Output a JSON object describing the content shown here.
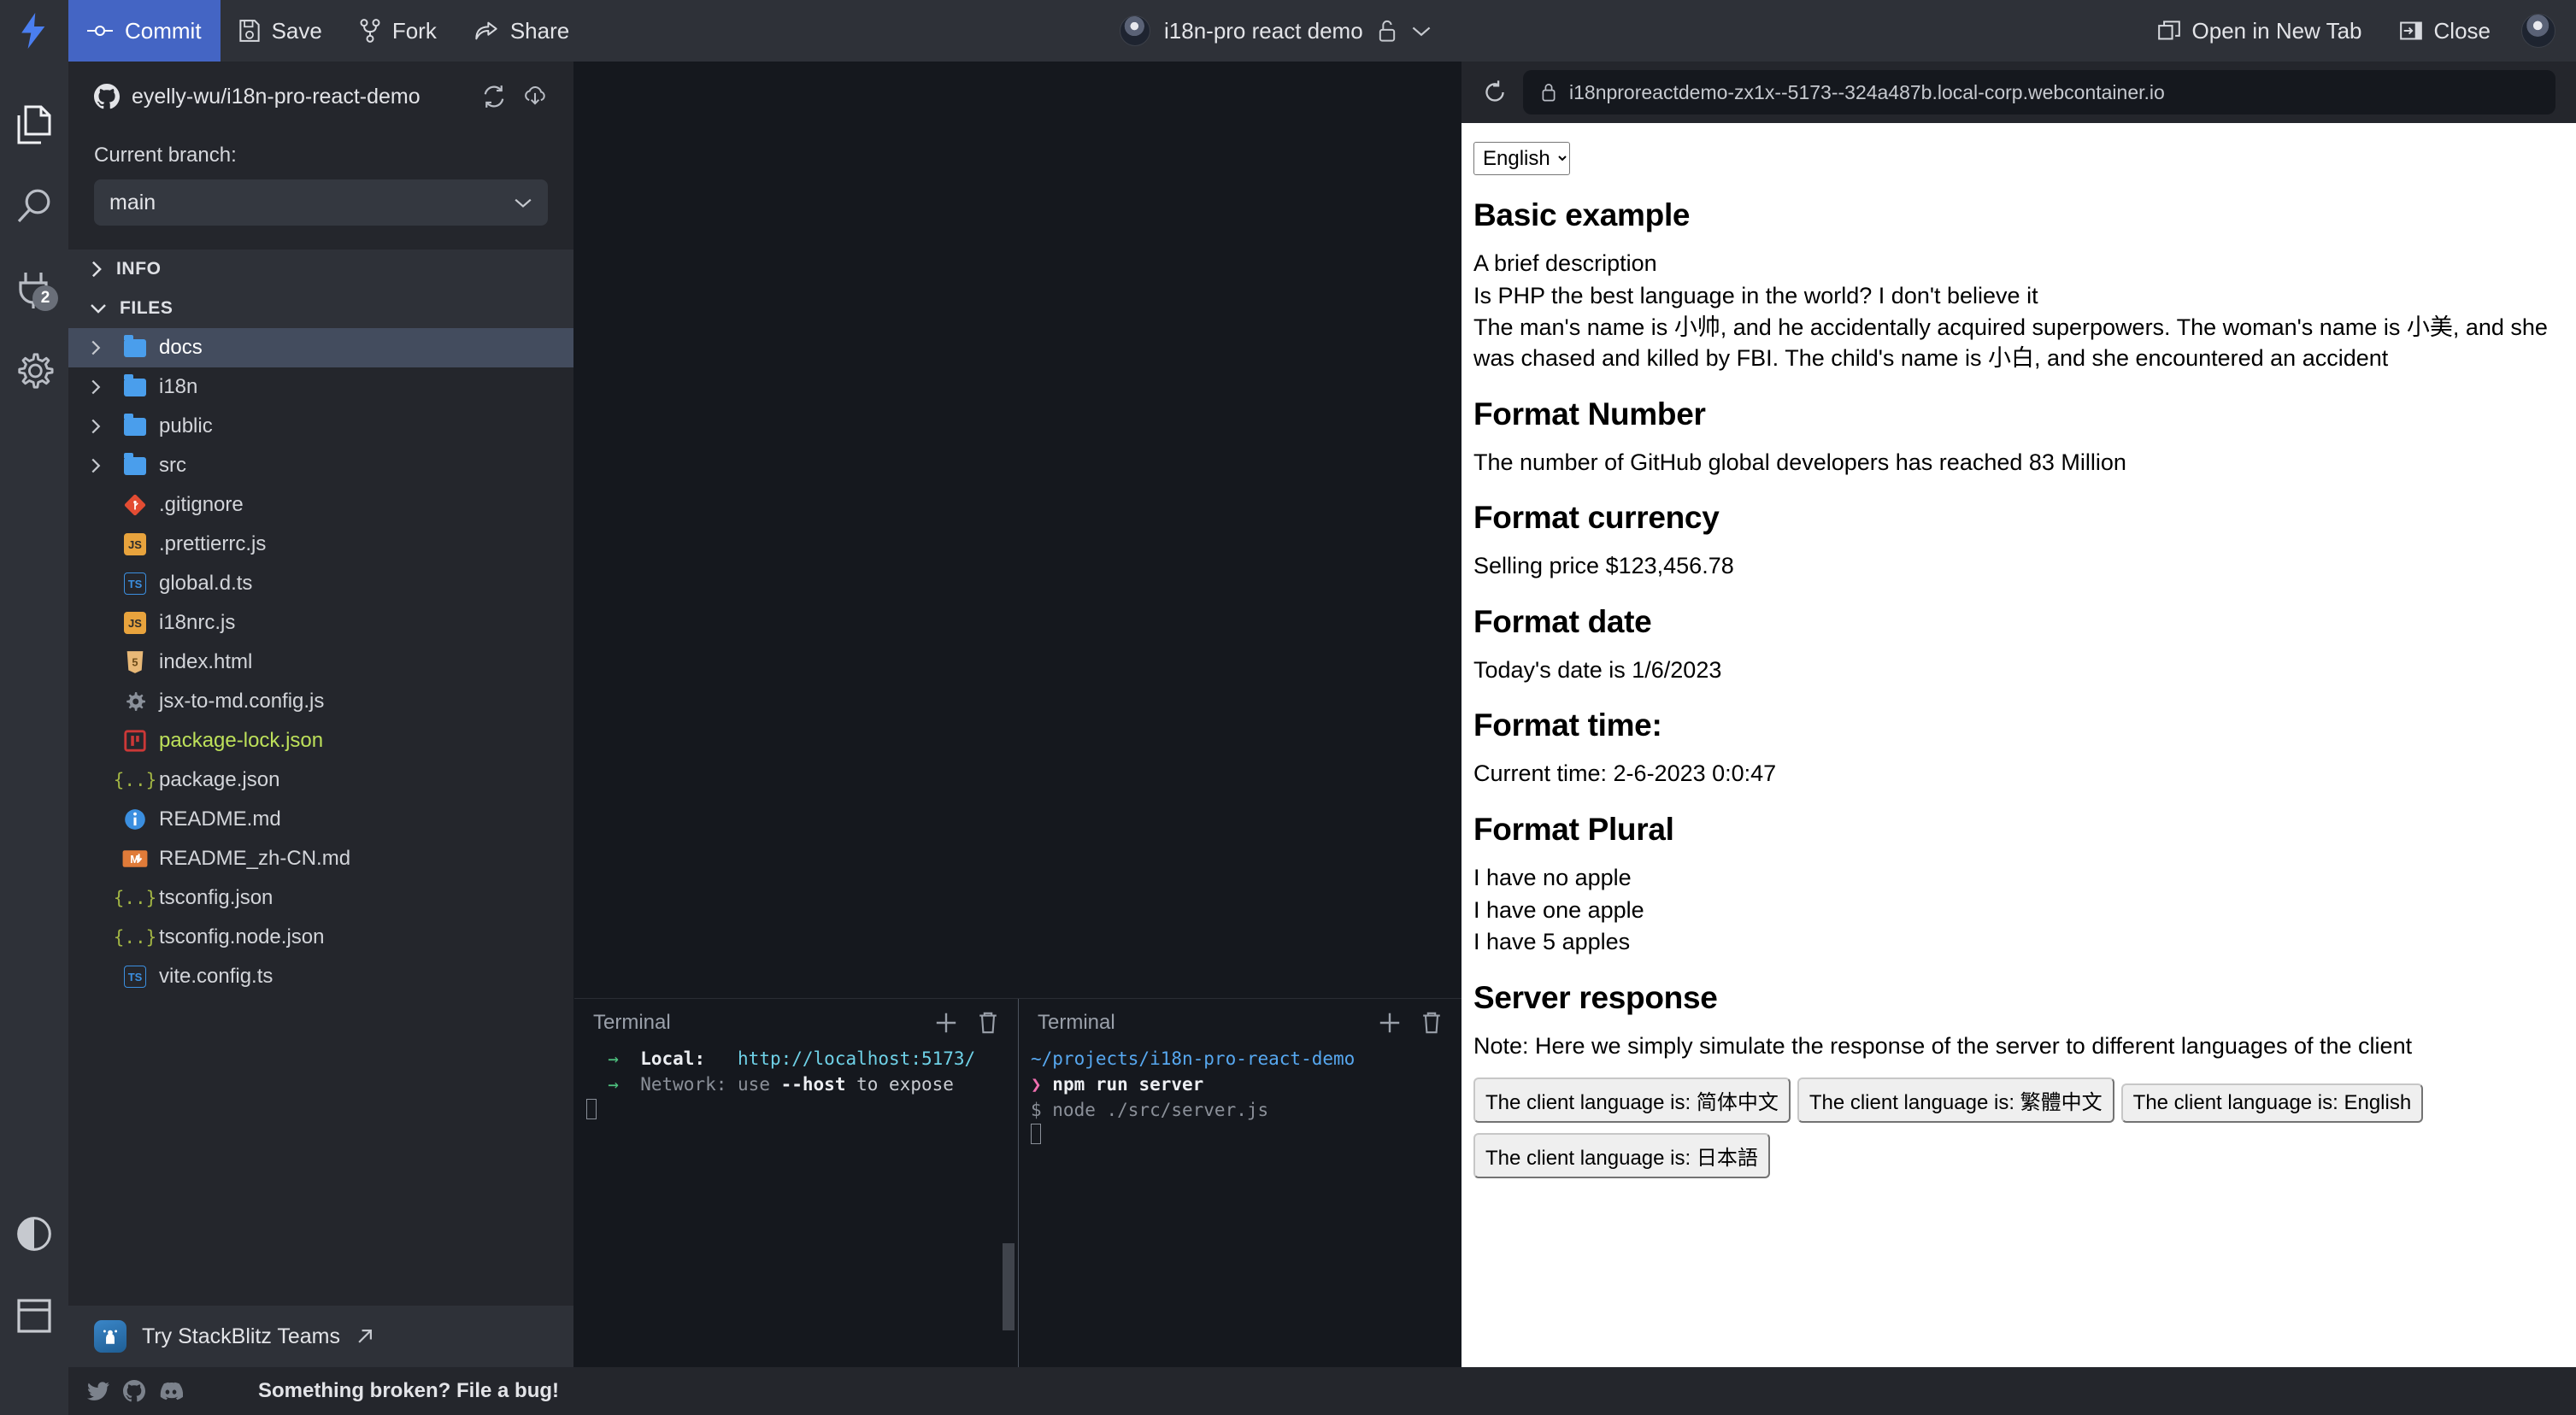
{
  "toolbar": {
    "logo_icon": "stackblitz-lightning-icon",
    "commit_label": "Commit",
    "save_label": "Save",
    "fork_label": "Fork",
    "share_label": "Share",
    "project_title": "i18n-pro react demo",
    "lock_icon": "unlock-icon",
    "chevron_icon": "chevron-down-icon",
    "open_new_tab_label": "Open in New Tab",
    "close_label": "Close",
    "commit_bg": "#4465c4"
  },
  "activity_bar": {
    "items": [
      {
        "icon": "files-icon",
        "name": "files"
      },
      {
        "icon": "search-icon",
        "name": "search"
      },
      {
        "icon": "plug-icon",
        "name": "plugins",
        "badge": "2"
      },
      {
        "icon": "gear-icon",
        "name": "settings"
      }
    ],
    "bottom": [
      {
        "icon": "theme-contrast-icon",
        "name": "theme"
      },
      {
        "icon": "layout-panel-icon",
        "name": "layout"
      }
    ]
  },
  "sidebar": {
    "repo_name": "eyelly-wu/i18n-pro-react-demo",
    "repo_icon": "github-icon",
    "sync_icon": "sync-icon",
    "pull_icon": "cloud-download-icon",
    "branch_label": "Current branch:",
    "branch_value": "main",
    "sections": [
      {
        "label": "INFO",
        "expanded": false
      },
      {
        "label": "FILES",
        "expanded": true
      }
    ],
    "files": [
      {
        "name": "docs",
        "type": "folder",
        "selected": true
      },
      {
        "name": "i18n",
        "type": "folder",
        "selected": false
      },
      {
        "name": "public",
        "type": "folder",
        "selected": false
      },
      {
        "name": "src",
        "type": "folder",
        "selected": false
      },
      {
        "name": ".gitignore",
        "type": "file",
        "icon": "git-icon",
        "color": "#e34c33"
      },
      {
        "name": ".prettierrc.js",
        "type": "file",
        "icon": "js-icon",
        "color": "#e8a33d",
        "label": "JS"
      },
      {
        "name": "global.d.ts",
        "type": "file",
        "icon": "ts-icon",
        "color": "#3b8fe0",
        "label": "TS"
      },
      {
        "name": "i18nrc.js",
        "type": "file",
        "icon": "js-icon",
        "color": "#e8a33d",
        "label": "JS"
      },
      {
        "name": "index.html",
        "type": "file",
        "icon": "html-icon",
        "color": "#e8b877"
      },
      {
        "name": "jsx-to-md.config.js",
        "type": "file",
        "icon": "gear-file-icon",
        "color": "#8b919b"
      },
      {
        "name": "package-lock.json",
        "type": "file",
        "icon": "npm-lock-icon",
        "color": "#cb3837",
        "modified": true
      },
      {
        "name": "package.json",
        "type": "file",
        "icon": "json-icon",
        "color": "#a3b644"
      },
      {
        "name": "README.md",
        "type": "file",
        "icon": "info-icon",
        "color": "#3b8fe0"
      },
      {
        "name": "README_zh-CN.md",
        "type": "file",
        "icon": "markdown-icon",
        "color": "#e07b39"
      },
      {
        "name": "tsconfig.json",
        "type": "file",
        "icon": "json-icon",
        "color": "#a3b644"
      },
      {
        "name": "tsconfig.node.json",
        "type": "file",
        "icon": "json-icon",
        "color": "#a3b644"
      },
      {
        "name": "vite.config.ts",
        "type": "file",
        "icon": "ts-icon",
        "color": "#3b8fe0",
        "label": "TS"
      }
    ],
    "teams_label": "Try StackBlitz Teams",
    "teams_icon": "teams-icon",
    "external_icon": "arrow-up-right-icon"
  },
  "terminals": [
    {
      "title": "Terminal",
      "add_icon": "plus-icon",
      "delete_icon": "trash-icon",
      "lines": [
        {
          "segments": [
            {
              "text": "  →  ",
              "style": "green"
            },
            {
              "text": "Local:",
              "style": "white"
            },
            {
              "text": "   ",
              "style": "plain"
            },
            {
              "text": "http://localhost:5173/",
              "style": "cyan"
            }
          ]
        },
        {
          "segments": [
            {
              "text": "  →  ",
              "style": "green"
            },
            {
              "text": "Network:",
              "style": "gray"
            },
            {
              "text": " use ",
              "style": "gray"
            },
            {
              "text": "--host",
              "style": "white"
            },
            {
              "text": " to expose",
              "style": "plain"
            }
          ]
        }
      ],
      "has_cursor": true,
      "has_scrollbar": true
    },
    {
      "title": "Terminal",
      "add_icon": "plus-icon",
      "delete_icon": "trash-icon",
      "lines": [
        {
          "segments": [
            {
              "text": "~/projects/i18n-pro-react-demo",
              "style": "blue"
            }
          ]
        },
        {
          "segments": [
            {
              "text": "❯ ",
              "style": "pink"
            },
            {
              "text": "npm run server",
              "style": "white"
            }
          ]
        },
        {
          "segments": [
            {
              "text": "$ node ./src/server.js",
              "style": "gray"
            }
          ]
        }
      ],
      "has_cursor": true,
      "has_scrollbar": false
    }
  ],
  "preview": {
    "reload_icon": "reload-icon",
    "lock_icon": "lock-icon",
    "url": "i18nproreactdemo-zx1x--5173--324a487b.local-corp.webcontainer.io",
    "language_selected": "English",
    "language_options": [
      "English"
    ],
    "sections": [
      {
        "heading": "Basic example",
        "paragraphs": [
          "A brief description",
          "Is PHP the best language in the world? I don't believe it",
          "The man's name is 小帅, and he accidentally acquired superpowers. The woman's name is 小美, and she was chased and killed by FBI. The child's name is 小白, and she encountered an accident"
        ]
      },
      {
        "heading": "Format Number",
        "paragraphs": [
          "The number of GitHub global developers has reached 83 Million"
        ]
      },
      {
        "heading": "Format currency",
        "paragraphs": [
          "Selling price $123,456.78"
        ]
      },
      {
        "heading": "Format date",
        "paragraphs": [
          "Today's date is 1/6/2023"
        ]
      },
      {
        "heading": "Format time:",
        "paragraphs": [
          "Current time: 2-6-2023 0:0:47"
        ]
      },
      {
        "heading": "Format Plural",
        "paragraphs": [
          "I have no apple",
          "I have one apple",
          "I have 5 apples"
        ]
      },
      {
        "heading": "Server response",
        "paragraphs": [
          "Note: Here we simply simulate the response of the server to different languages of the client"
        ]
      }
    ],
    "server_buttons": [
      "The client language is: 简体中文",
      "The client language is: 繁體中文",
      "The client language is: English",
      "The client language is: 日本語"
    ]
  },
  "statusbar": {
    "social": [
      "twitter-icon",
      "github-icon",
      "discord-icon"
    ],
    "message": "Something broken? File a bug!"
  }
}
